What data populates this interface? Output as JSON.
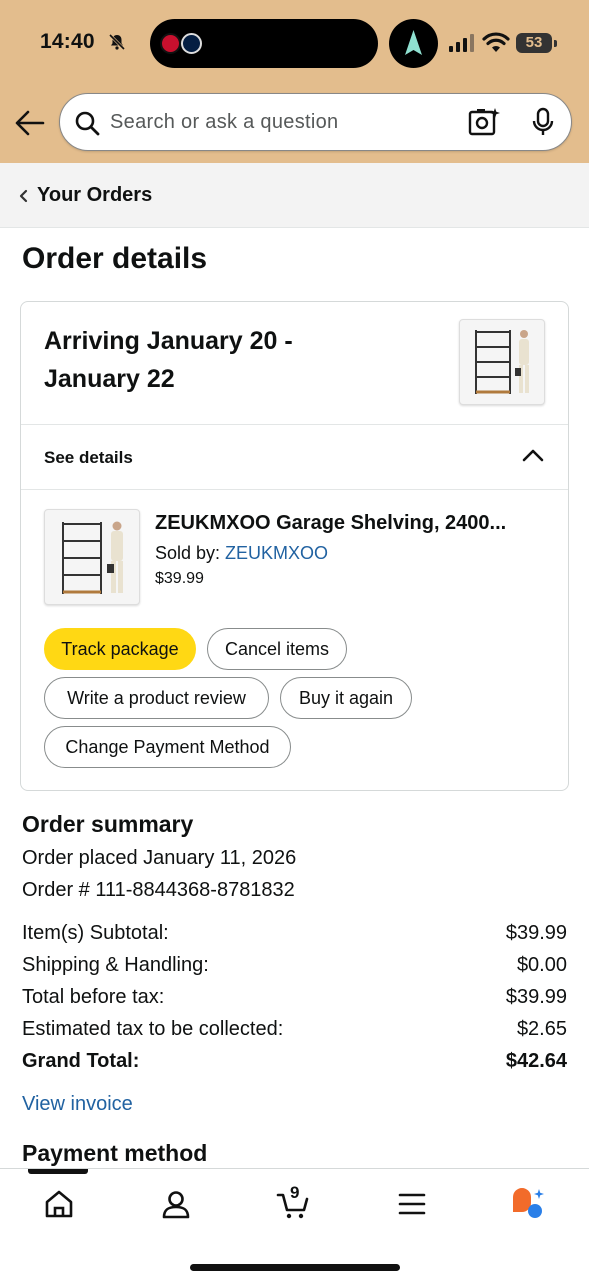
{
  "status_bar": {
    "time": "14:40",
    "battery": "53"
  },
  "header": {
    "search_placeholder": "Search or ask a question"
  },
  "breadcrumb": {
    "label": "Your Orders"
  },
  "page": {
    "title": "Order details"
  },
  "shipment": {
    "arriving": "Arriving January 20 - January 22",
    "see_details": "See details",
    "item": {
      "title": "ZEUKMXOO Garage Shelving, 2400...",
      "sold_by_prefix": "Sold by: ",
      "seller": "ZEUKMXOO",
      "price": "$39.99"
    },
    "actions": {
      "track": "Track package",
      "cancel": "Cancel items",
      "review": "Write a product review",
      "buy_again": "Buy it again",
      "change_payment": "Change Payment Method"
    }
  },
  "summary": {
    "heading": "Order summary",
    "placed": "Order placed January 11, 2026",
    "order_number": "Order # 111-8844368-8781832",
    "rows": [
      {
        "label": "Item(s) Subtotal:",
        "value": "$39.99"
      },
      {
        "label": "Shipping & Handling:",
        "value": "$0.00"
      },
      {
        "label": "Total before tax:",
        "value": "$39.99"
      },
      {
        "label": "Estimated tax to be collected:",
        "value": "$2.65"
      },
      {
        "label": "Grand Total:",
        "value": "$42.64"
      }
    ],
    "view_invoice": "View invoice"
  },
  "payment": {
    "heading": "Payment method"
  },
  "bottom_nav": {
    "cart_count": "9",
    "items": [
      "home-icon",
      "account-icon",
      "cart-icon",
      "menu-icon",
      "rufus-icon"
    ]
  },
  "colors": {
    "header_bg": "#e3bd8d",
    "primary_button": "#ffd814",
    "link": "#2162a1"
  }
}
